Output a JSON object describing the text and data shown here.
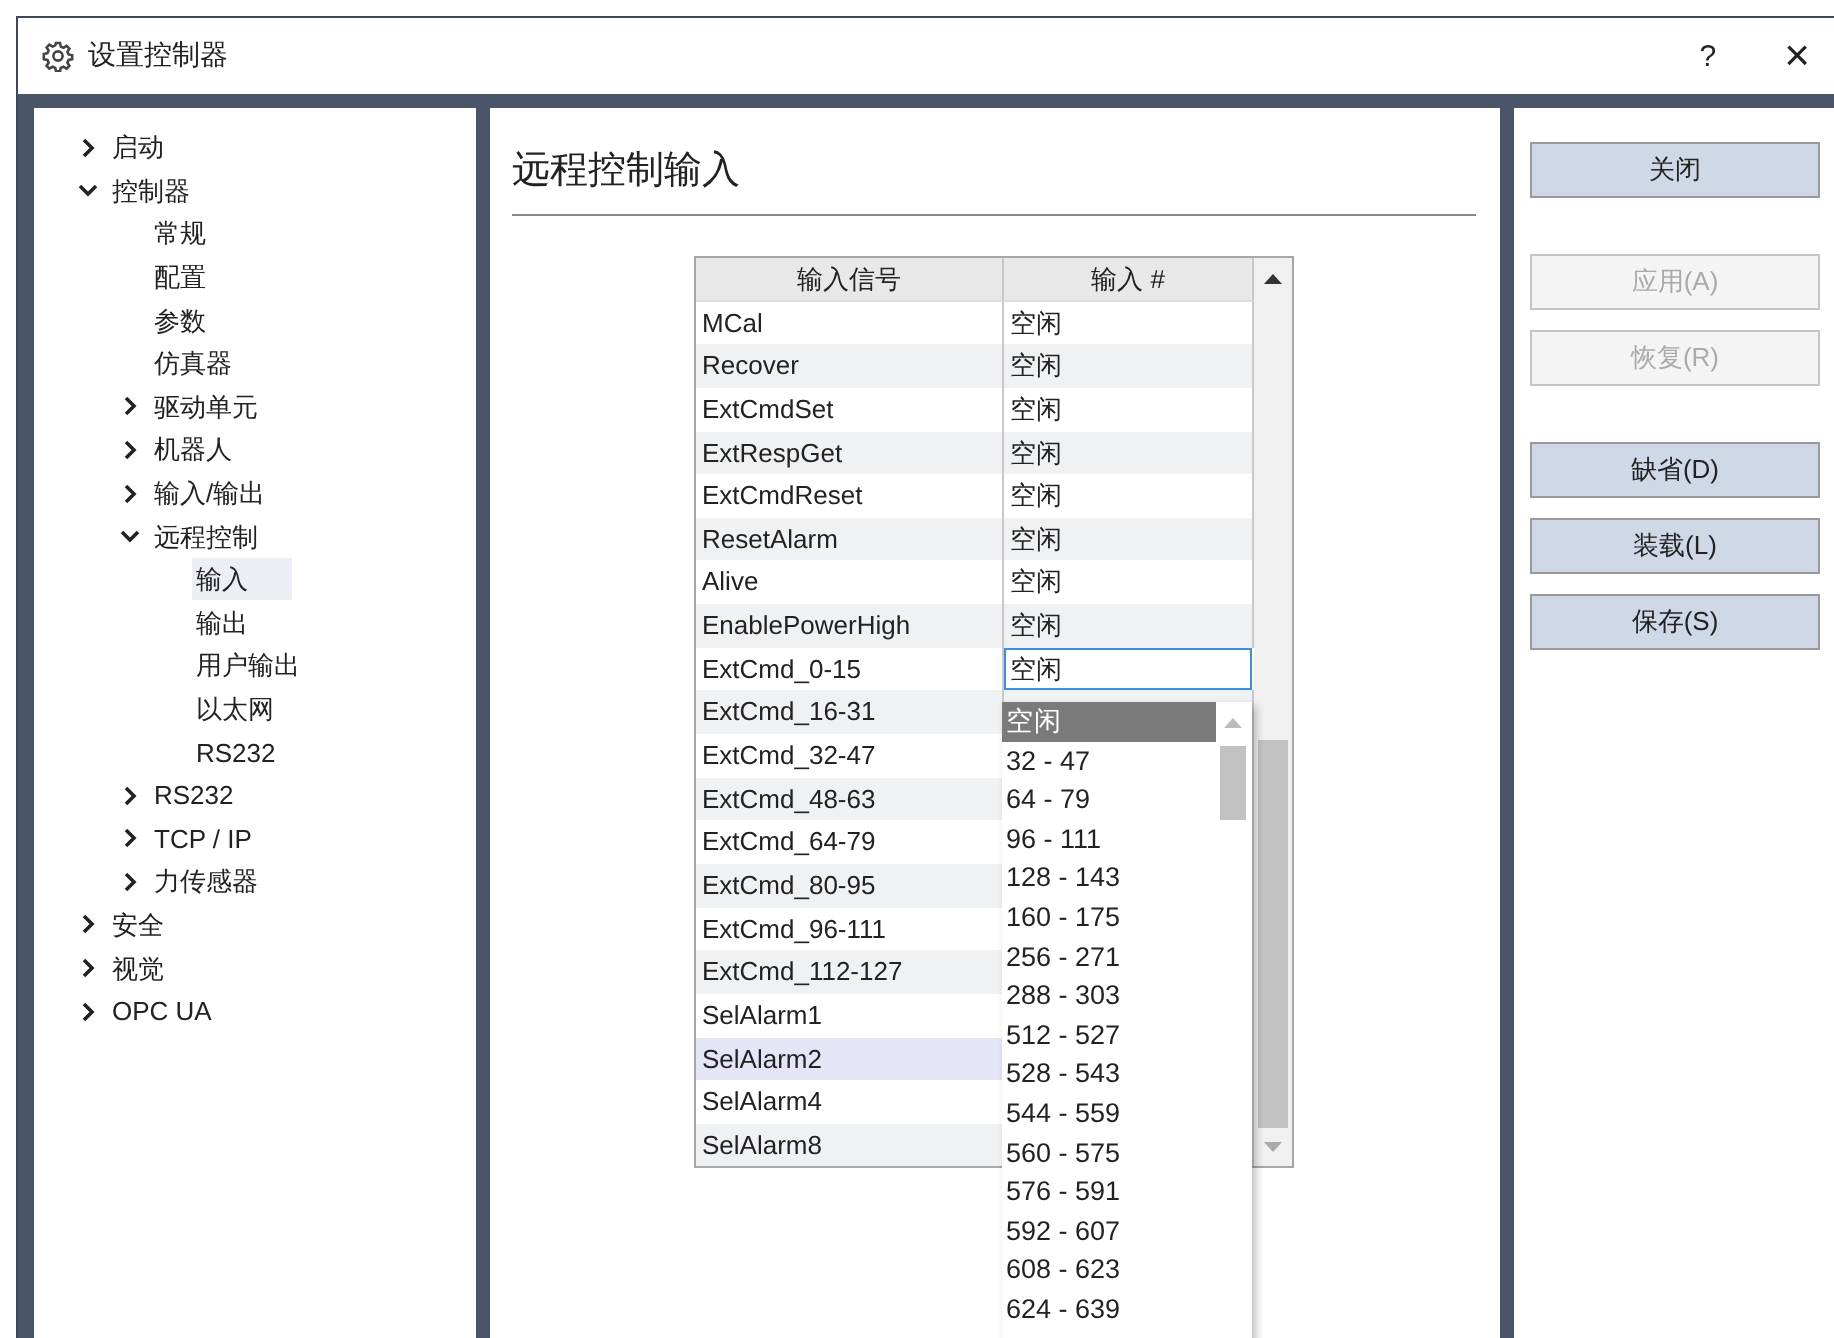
{
  "window": {
    "title": "设置控制器",
    "help": "?",
    "close": "×"
  },
  "tree": [
    {
      "label": "启动",
      "expanded": false,
      "selected": false
    },
    {
      "label": "控制器",
      "expanded": true,
      "selected": false,
      "children": [
        {
          "label": "常规",
          "selected": false
        },
        {
          "label": "配置",
          "selected": false
        },
        {
          "label": "参数",
          "selected": false
        },
        {
          "label": "仿真器",
          "selected": false
        },
        {
          "label": "驱动单元",
          "expanded": false,
          "selected": false
        },
        {
          "label": "机器人",
          "expanded": false,
          "selected": false
        },
        {
          "label": "输入/输出",
          "expanded": false,
          "selected": false
        },
        {
          "label": "远程控制",
          "expanded": true,
          "selected": false,
          "children": [
            {
              "label": "输入",
              "selected": true
            },
            {
              "label": "输出",
              "selected": false
            },
            {
              "label": "用户输出",
              "selected": false
            },
            {
              "label": "以太网",
              "selected": false
            },
            {
              "label": "RS232",
              "selected": false
            }
          ]
        },
        {
          "label": "RS232",
          "expanded": false,
          "selected": false
        },
        {
          "label": "TCP / IP",
          "expanded": false,
          "selected": false
        },
        {
          "label": "力传感器",
          "expanded": false,
          "selected": false
        }
      ]
    },
    {
      "label": "安全",
      "expanded": false,
      "selected": false
    },
    {
      "label": "视觉",
      "expanded": false,
      "selected": false
    },
    {
      "label": "OPC UA",
      "expanded": false,
      "selected": false
    }
  ],
  "heading": "远程控制输入",
  "table": {
    "columns": [
      "输入信号",
      "输入 #"
    ],
    "rows": [
      {
        "signal": "MCal",
        "input": "空闲",
        "editing": false,
        "highlighted": false
      },
      {
        "signal": "Recover",
        "input": "空闲",
        "editing": false,
        "highlighted": false
      },
      {
        "signal": "ExtCmdSet",
        "input": "空闲",
        "editing": false,
        "highlighted": false
      },
      {
        "signal": "ExtRespGet",
        "input": "空闲",
        "editing": false,
        "highlighted": false
      },
      {
        "signal": "ExtCmdReset",
        "input": "空闲",
        "editing": false,
        "highlighted": false
      },
      {
        "signal": "ResetAlarm",
        "input": "空闲",
        "editing": false,
        "highlighted": false
      },
      {
        "signal": "Alive",
        "input": "空闲",
        "editing": false,
        "highlighted": false
      },
      {
        "signal": "EnablePowerHigh",
        "input": "空闲",
        "editing": false,
        "highlighted": false
      },
      {
        "signal": "ExtCmd_0-15",
        "input": "空闲",
        "editing": true,
        "highlighted": false
      },
      {
        "signal": "ExtCmd_16-31",
        "highlighted": false
      },
      {
        "signal": "ExtCmd_32-47",
        "highlighted": false
      },
      {
        "signal": "ExtCmd_48-63",
        "highlighted": false
      },
      {
        "signal": "ExtCmd_64-79",
        "highlighted": false
      },
      {
        "signal": "ExtCmd_80-95",
        "highlighted": false
      },
      {
        "signal": "ExtCmd_96-111",
        "highlighted": false
      },
      {
        "signal": "ExtCmd_112-127",
        "highlighted": false
      },
      {
        "signal": "SelAlarm1",
        "highlighted": false
      },
      {
        "signal": "SelAlarm2",
        "highlighted": true
      },
      {
        "signal": "SelAlarm4",
        "highlighted": false
      },
      {
        "signal": "SelAlarm8",
        "highlighted": false
      }
    ]
  },
  "dropdown": [
    {
      "label": "空闲",
      "selected": true
    },
    {
      "label": "32 - 47",
      "selected": false
    },
    {
      "label": "64 - 79",
      "selected": false
    },
    {
      "label": "96 - 111",
      "selected": false
    },
    {
      "label": "128 - 143",
      "selected": false
    },
    {
      "label": "160 - 175",
      "selected": false
    },
    {
      "label": "256 - 271",
      "selected": false
    },
    {
      "label": "288 - 303",
      "selected": false
    },
    {
      "label": "512 - 527",
      "selected": false
    },
    {
      "label": "528 - 543",
      "selected": false
    },
    {
      "label": "544 - 559",
      "selected": false
    },
    {
      "label": "560 - 575",
      "selected": false
    },
    {
      "label": "576 - 591",
      "selected": false
    },
    {
      "label": "592 - 607",
      "selected": false
    },
    {
      "label": "608 - 623",
      "selected": false
    },
    {
      "label": "624 - 639",
      "selected": false
    }
  ],
  "button_groups": [
    [
      {
        "label": "关闭",
        "disabled": false
      }
    ],
    [
      {
        "label": "应用(A)",
        "disabled": true
      },
      {
        "label": "恢复(R)",
        "disabled": true
      }
    ],
    [
      {
        "label": "缺省(D)",
        "disabled": false
      },
      {
        "label": "装载(L)",
        "disabled": false
      },
      {
        "label": "保存(S)",
        "disabled": false
      }
    ]
  ]
}
